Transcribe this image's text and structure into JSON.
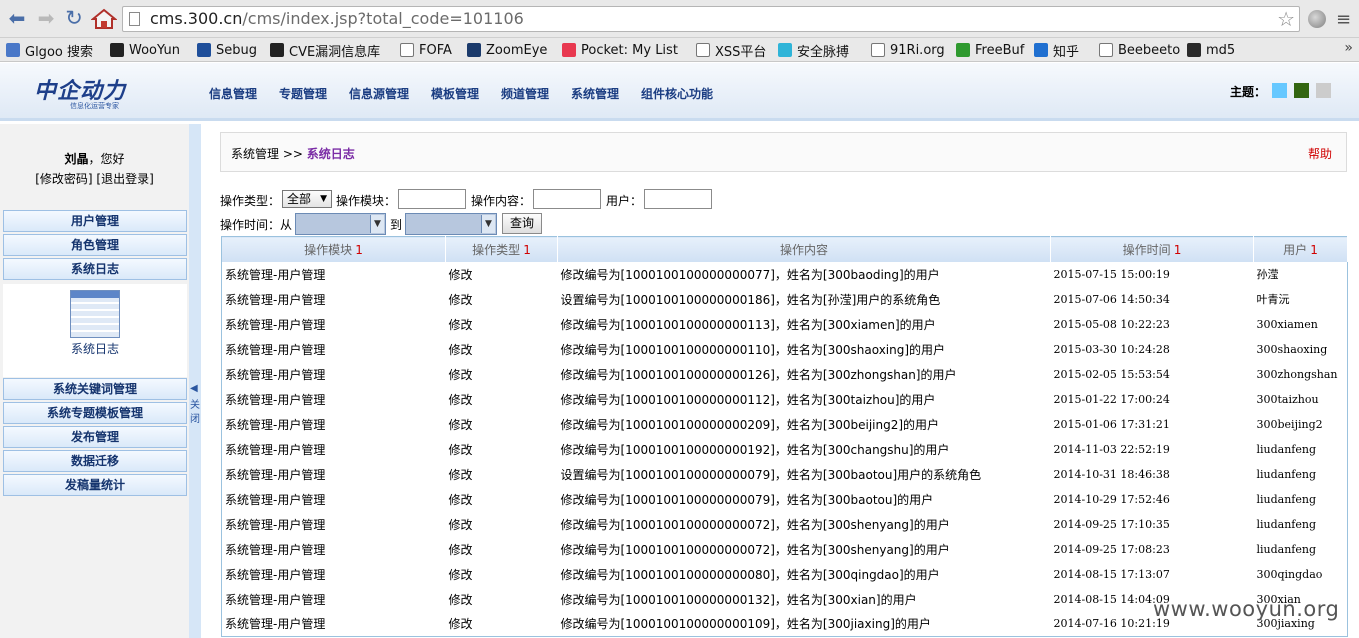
{
  "browser": {
    "url_host": "cms.300.cn",
    "url_path": "/cms/index.jsp?total_code=101106",
    "bookmarks": [
      {
        "label": "Glgoo 搜索",
        "icon": "search-icon",
        "color": "#4a78c8"
      },
      {
        "label": "WooYun",
        "icon": "wooyun-icon",
        "color": "#222222"
      },
      {
        "label": "Sebug",
        "icon": "sebug-icon",
        "color": "#1f4f9a"
      },
      {
        "label": "CVE漏洞信息库",
        "icon": "cve-icon",
        "color": "#222222"
      },
      {
        "label": "FOFA",
        "icon": "page-icon",
        "color": "#ffffff"
      },
      {
        "label": "ZoomEye",
        "icon": "zoomeye-icon",
        "color": "#1b3a6b"
      },
      {
        "label": "Pocket: My List",
        "icon": "pocket-icon",
        "color": "#e8384f"
      },
      {
        "label": "XSS平台",
        "icon": "page-icon",
        "color": "#ffffff"
      },
      {
        "label": "安全脉搏",
        "icon": "cloud-icon",
        "color": "#2fb4d8"
      },
      {
        "label": "91Ri.org",
        "icon": "page-icon",
        "color": "#ffffff"
      },
      {
        "label": "FreeBuf",
        "icon": "freebuf-icon",
        "color": "#2f9a2f"
      },
      {
        "label": "知乎",
        "icon": "zhihu-icon",
        "color": "#1f6fd0"
      },
      {
        "label": "Beebeeto",
        "icon": "page-icon",
        "color": "#ffffff"
      },
      {
        "label": "md5",
        "icon": "grid-icon",
        "color": "#2a2a2a"
      }
    ],
    "more": "»"
  },
  "header": {
    "logo_main": "中企动力",
    "logo_sub": "信息化运营专家",
    "nav": [
      "信息管理",
      "专题管理",
      "信息源管理",
      "模板管理",
      "频道管理",
      "系统管理",
      "组件核心功能"
    ],
    "theme_label": "主题：",
    "theme_colors": [
      "#66c8ff",
      "#336611",
      "#cccccc"
    ]
  },
  "sidebar": {
    "user_name": "刘晶",
    "greeting_suffix": "，您好",
    "change_password": "[修改密码]",
    "logout": "[退出登录]",
    "top_items": [
      "用户管理",
      "角色管理",
      "系统日志"
    ],
    "panel_label": "系统日志",
    "bottom_items": [
      "系统关键词管理",
      "系统专题模板管理",
      "发布管理",
      "数据迁移",
      "发稿量统计"
    ],
    "collapse_arrow": "◀",
    "collapse_text": "关闭"
  },
  "main": {
    "breadcrumb_parent": "系统管理",
    "breadcrumb_sep": " >> ",
    "breadcrumb_current": "系统日志",
    "help": "帮助",
    "filters": {
      "type_label": "操作类型：",
      "type_value": "全部",
      "module_label": "操作模块：",
      "content_label": "操作内容：",
      "user_label": "用户：",
      "time_label": "操作时间：从",
      "to_label": "到",
      "query_button": "查询"
    },
    "table": {
      "columns": [
        {
          "label": "操作模块",
          "sort": "1"
        },
        {
          "label": "操作类型",
          "sort": "1"
        },
        {
          "label": "操作内容",
          "sort": ""
        },
        {
          "label": "操作时间",
          "sort": "1"
        },
        {
          "label": "用户",
          "sort": "1"
        }
      ],
      "rows": [
        [
          "系统管理-用户管理",
          "修改",
          "修改编号为[1000100100000000077]，姓名为[300baoding]的用户",
          "2015-07-15 15:00:19",
          "孙滢"
        ],
        [
          "系统管理-用户管理",
          "修改",
          "设置编号为[1000100100000000186]，姓名为[孙滢]用户的系统角色",
          "2015-07-06 14:50:34",
          "叶青沅"
        ],
        [
          "系统管理-用户管理",
          "修改",
          "修改编号为[1000100100000000113]，姓名为[300xiamen]的用户",
          "2015-05-08 10:22:23",
          "300xiamen"
        ],
        [
          "系统管理-用户管理",
          "修改",
          "修改编号为[1000100100000000110]，姓名为[300shaoxing]的用户",
          "2015-03-30 10:24:28",
          "300shaoxing"
        ],
        [
          "系统管理-用户管理",
          "修改",
          "修改编号为[1000100100000000126]，姓名为[300zhongshan]的用户",
          "2015-02-05 15:53:54",
          "300zhongshan"
        ],
        [
          "系统管理-用户管理",
          "修改",
          "修改编号为[1000100100000000112]，姓名为[300taizhou]的用户",
          "2015-01-22 17:00:24",
          "300taizhou"
        ],
        [
          "系统管理-用户管理",
          "修改",
          "修改编号为[1000100100000000209]，姓名为[300beijing2]的用户",
          "2015-01-06 17:31:21",
          "300beijing2"
        ],
        [
          "系统管理-用户管理",
          "修改",
          "修改编号为[1000100100000000192]，姓名为[300changshu]的用户",
          "2014-11-03 22:52:19",
          "liudanfeng"
        ],
        [
          "系统管理-用户管理",
          "修改",
          "设置编号为[1000100100000000079]，姓名为[300baotou]用户的系统角色",
          "2014-10-31 18:46:38",
          "liudanfeng"
        ],
        [
          "系统管理-用户管理",
          "修改",
          "修改编号为[1000100100000000079]，姓名为[300baotou]的用户",
          "2014-10-29 17:52:46",
          "liudanfeng"
        ],
        [
          "系统管理-用户管理",
          "修改",
          "修改编号为[1000100100000000072]，姓名为[300shenyang]的用户",
          "2014-09-25 17:10:35",
          "liudanfeng"
        ],
        [
          "系统管理-用户管理",
          "修改",
          "修改编号为[1000100100000000072]，姓名为[300shenyang]的用户",
          "2014-09-25 17:08:23",
          "liudanfeng"
        ],
        [
          "系统管理-用户管理",
          "修改",
          "修改编号为[1000100100000000080]，姓名为[300qingdao]的用户",
          "2014-08-15 17:13:07",
          "300qingdao"
        ],
        [
          "系统管理-用户管理",
          "修改",
          "修改编号为[1000100100000000132]，姓名为[300xian]的用户",
          "2014-08-15 14:04:09",
          "300xian"
        ],
        [
          "系统管理-用户管理",
          "修改",
          "修改编号为[1000100100000000109]，姓名为[300jiaxing]的用户",
          "2014-07-16 10:21:19",
          "300jiaxing"
        ]
      ]
    }
  },
  "watermark": "www.wooyun.org"
}
